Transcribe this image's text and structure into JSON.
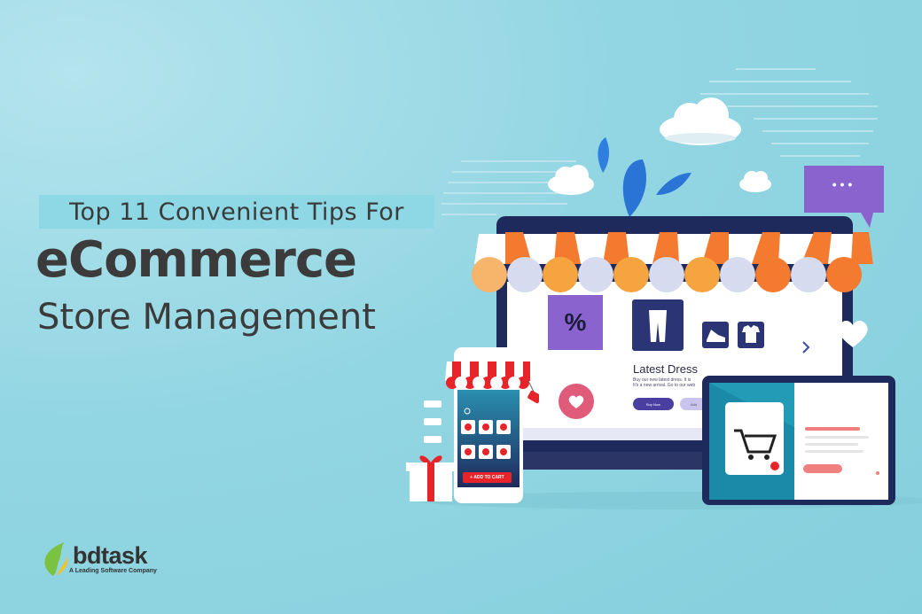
{
  "headline": {
    "tagline": "Top 11 Convenient Tips For",
    "main": "eCommerce",
    "sub": "Store Management"
  },
  "brand": {
    "name": "bdtask",
    "slogan": "A Leading Software Company"
  },
  "storefront": {
    "discount_symbol": "%",
    "product_title": "Latest Dress",
    "product_desc_line1": "Buy our new latest dress. It is",
    "product_desc_line2": "It's a new arrival. Go to our web",
    "buy_label": "Buy Now",
    "wish_label": "Add"
  },
  "mobile": {
    "add_to_cart": "+ ADD TO CART"
  },
  "chat_bubble": "• • •",
  "colors": {
    "headline_text": "#3b3b3b",
    "accent_orange": "#f47a2f",
    "accent_purple": "#8a63cf",
    "cart_red": "#e7242a",
    "screen_dark": "#1f2a5c"
  }
}
